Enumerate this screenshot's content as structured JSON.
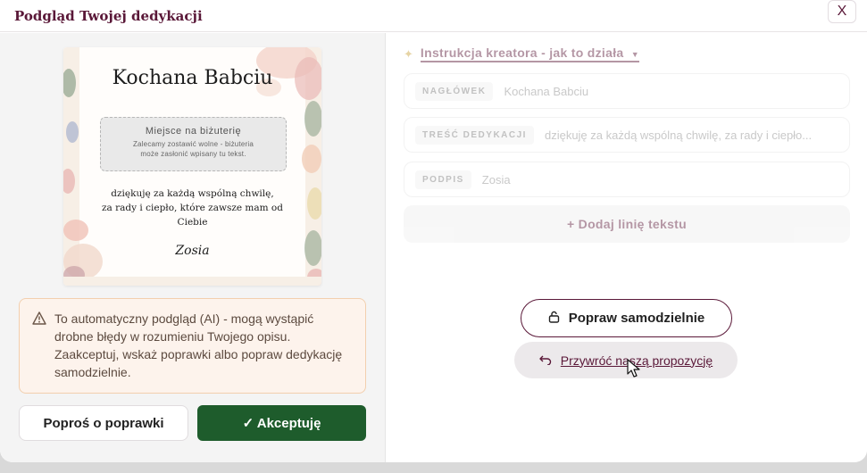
{
  "dialog": {
    "title": "Podgląd Twojej dedykacji",
    "close_label": "X"
  },
  "card": {
    "heading": "Kochana Babciu",
    "jewelry_title": "Miejsce na biżuterię",
    "jewelry_hint_1": "Zalecamy zostawić wolne - biżuteria",
    "jewelry_hint_2": "może zasłonić wpisany tu tekst.",
    "body_line_1": "dziękuję za każdą wspólną chwilę,",
    "body_line_2": "za rady i ciepło, które zawsze mam od Ciebie",
    "signature": "Zosia"
  },
  "warning": {
    "icon": "warning-triangle-icon",
    "text": "To automatyczny podgląd (AI) - mogą wystąpić drobne błędy w rozumieniu Twojego opisu. Zaakceptuj, wskaż poprawki albo popraw dedykację samodzielnie."
  },
  "actions": {
    "request_fix_label": "Poproś o poprawki",
    "accept_label": "✓ Akceptuję"
  },
  "editor": {
    "instructions_label": "Instrukcja kreatora - jak to działa",
    "fields": [
      {
        "tag": "NAGŁÓWEK",
        "value": "Kochana Babciu"
      },
      {
        "tag": "TREŚĆ DEDYKACJI",
        "value": "dziękuję za każdą wspólną chwilę, za rady i ciepło..."
      },
      {
        "tag": "PODPIS",
        "value": "Zosia"
      }
    ],
    "add_line_label": "+ Dodaj linię tekstu",
    "self_edit_label": "Popraw samodzielnie",
    "restore_label": "Przywróć naszą propozycję"
  },
  "colors": {
    "brand": "#5a1838",
    "accept": "#1e5c2c",
    "warning_bg": "#fdf3ec"
  }
}
